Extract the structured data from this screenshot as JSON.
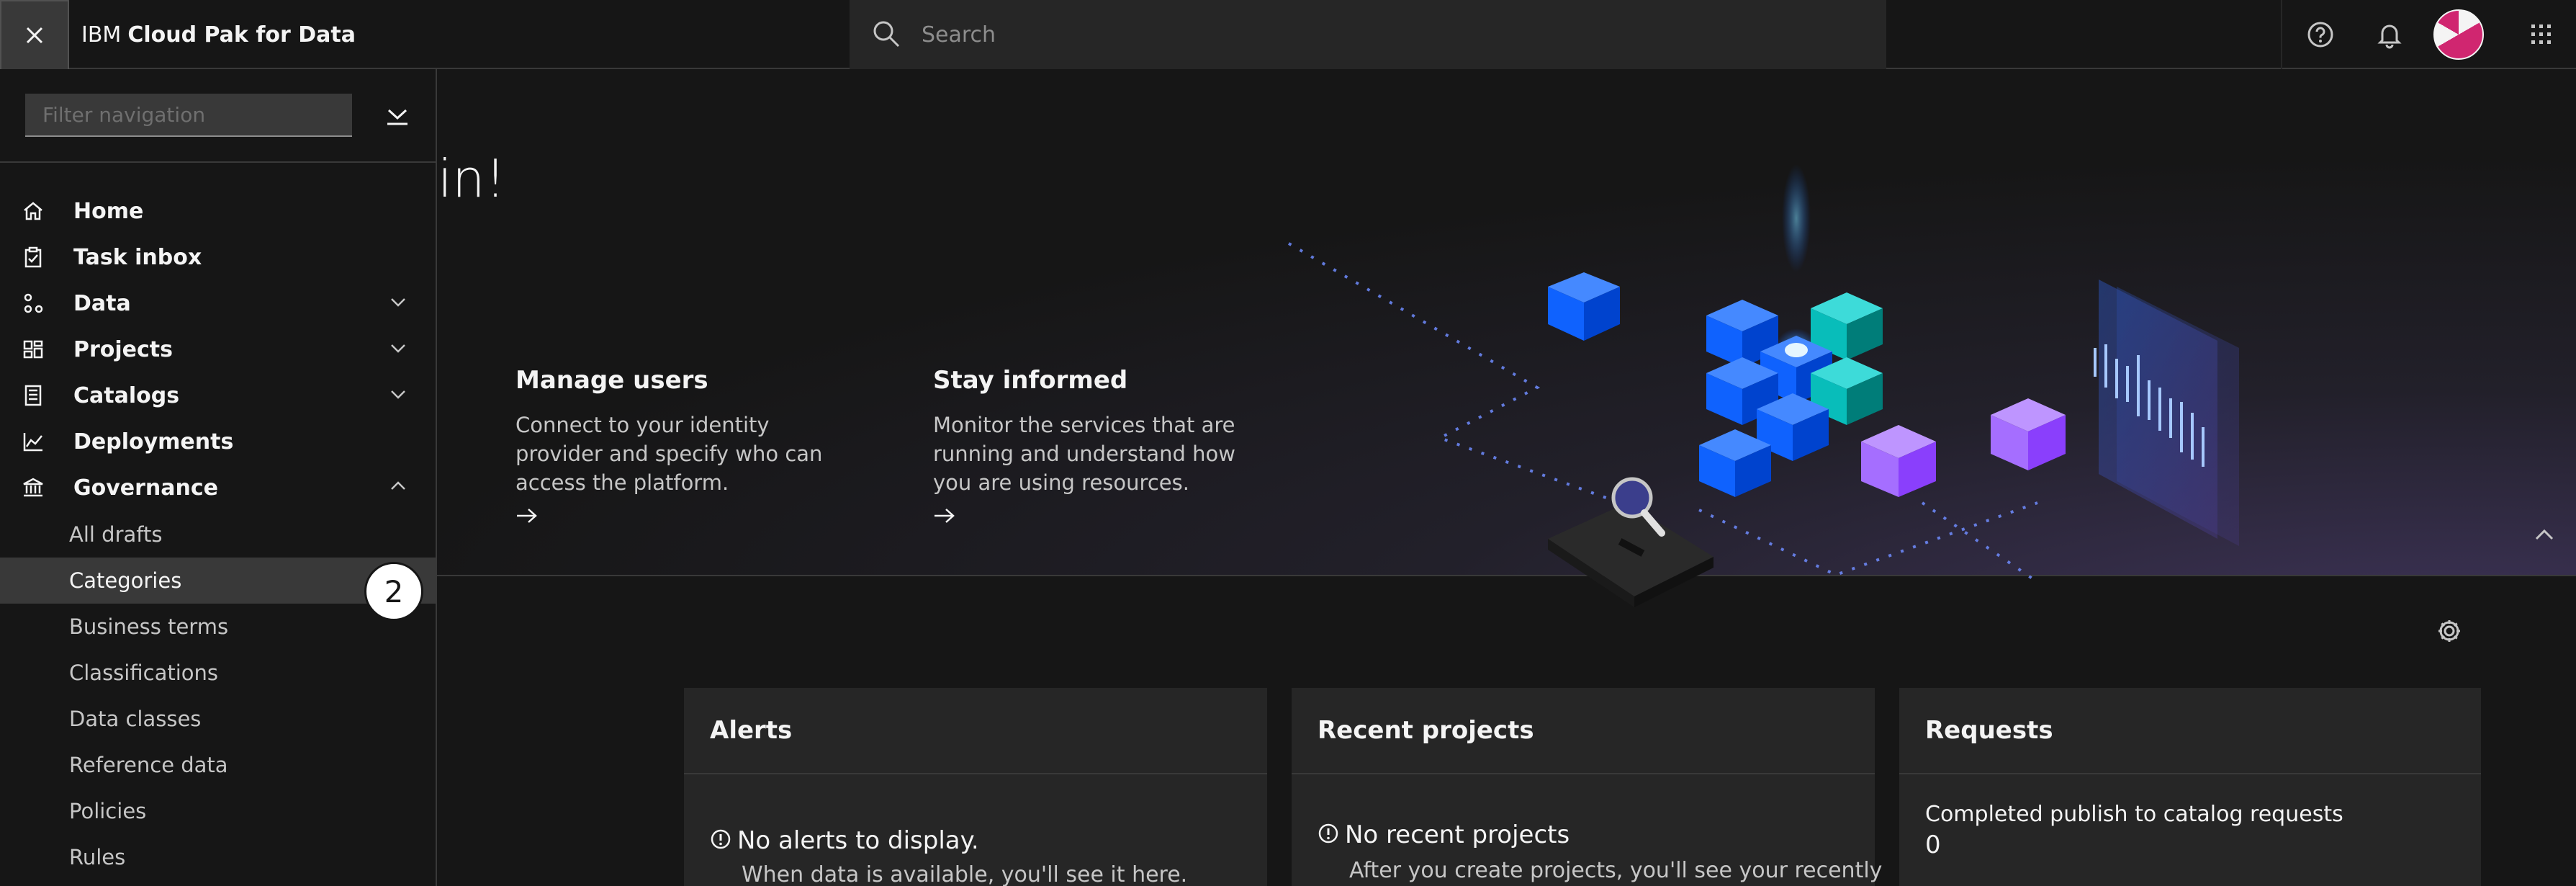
{
  "header": {
    "brand": "IBM",
    "product": "Cloud Pak for Data",
    "search_placeholder": "Search"
  },
  "sidenav": {
    "filter_placeholder": "Filter navigation",
    "items": [
      {
        "label": "Home",
        "icon": "home-icon"
      },
      {
        "label": "Task inbox",
        "icon": "task-icon"
      },
      {
        "label": "Data",
        "icon": "data-icon"
      },
      {
        "label": "Projects",
        "icon": "projects-icon"
      },
      {
        "label": "Catalogs",
        "icon": "catalog-icon"
      },
      {
        "label": "Deployments",
        "icon": "chart-line-icon"
      },
      {
        "label": "Governance",
        "icon": "bank-icon"
      }
    ],
    "governance_items": [
      {
        "label": "All drafts"
      },
      {
        "label": "Categories"
      },
      {
        "label": "Business terms"
      },
      {
        "label": "Classifications"
      },
      {
        "label": "Data classes"
      },
      {
        "label": "Reference data"
      },
      {
        "label": "Policies"
      },
      {
        "label": "Rules"
      }
    ],
    "active_item": "Categories",
    "step_badge": "2"
  },
  "hero": {
    "greeting": "in!",
    "cards": [
      {
        "title": "Manage users",
        "text": "Connect to your identity provider and specify who can access the platform."
      },
      {
        "title": "Stay informed",
        "text": "Monitor the services that are running and understand how you are using resources."
      }
    ]
  },
  "panels": {
    "alerts": {
      "title": "Alerts",
      "empty_title": "No alerts to display.",
      "empty_text": "When data is available, you'll see it here."
    },
    "recent_projects": {
      "title": "Recent projects",
      "empty_title": "No recent projects",
      "empty_text": "After you create projects, you'll see your recently"
    },
    "requests": {
      "title": "Requests",
      "label": "Completed publish to catalog requests",
      "value": "0"
    }
  },
  "colors": {
    "background": "#161616",
    "panel": "#262626",
    "active": "#393939",
    "accent_blue": "#0f62fe",
    "accent_teal": "#08bdba",
    "accent_purple": "#a56eff",
    "avatar_magenta": "#d02670"
  }
}
